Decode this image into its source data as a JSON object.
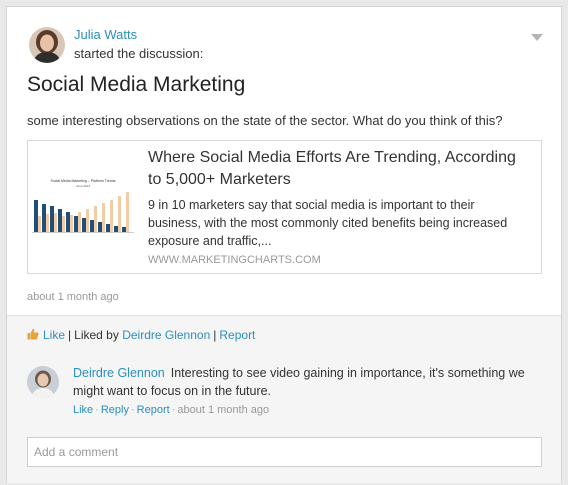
{
  "post": {
    "author": "Julia Watts",
    "action": "started the discussion:",
    "title": "Social Media Marketing",
    "body": "some interesting observations on the state of the sector. What do you think of this?",
    "timestamp": "about 1 month ago"
  },
  "link_preview": {
    "title": "Where Social Media Efforts Are Trending, According to 5,000+ Marketers",
    "description": "9 in 10 marketers say that social media is important to their business, with the most commonly cited benefits being increased exposure and traffic,...",
    "domain": "WWW.MARKETINGCHARTS.COM",
    "thumbnail_title": "Social Media Marketing – Platform Trends",
    "thumbnail_subtitle": "June 2014"
  },
  "likes": {
    "like_label": "Like",
    "liked_by_prefix": "Liked by",
    "liked_by_name": "Deirdre Glennon",
    "report_label": "Report"
  },
  "comment": {
    "author": "Deirdre Glennon",
    "text": "Interesting to see video gaining in importance, it's something we might want to focus on in the future.",
    "like_label": "Like",
    "reply_label": "Reply",
    "report_label": "Report",
    "timestamp": "about 1 month ago"
  },
  "composer": {
    "placeholder": "Add a comment"
  },
  "colors": {
    "link": "#2a8fbd",
    "muted": "#999999",
    "footer_bg": "#f5f5f5"
  }
}
